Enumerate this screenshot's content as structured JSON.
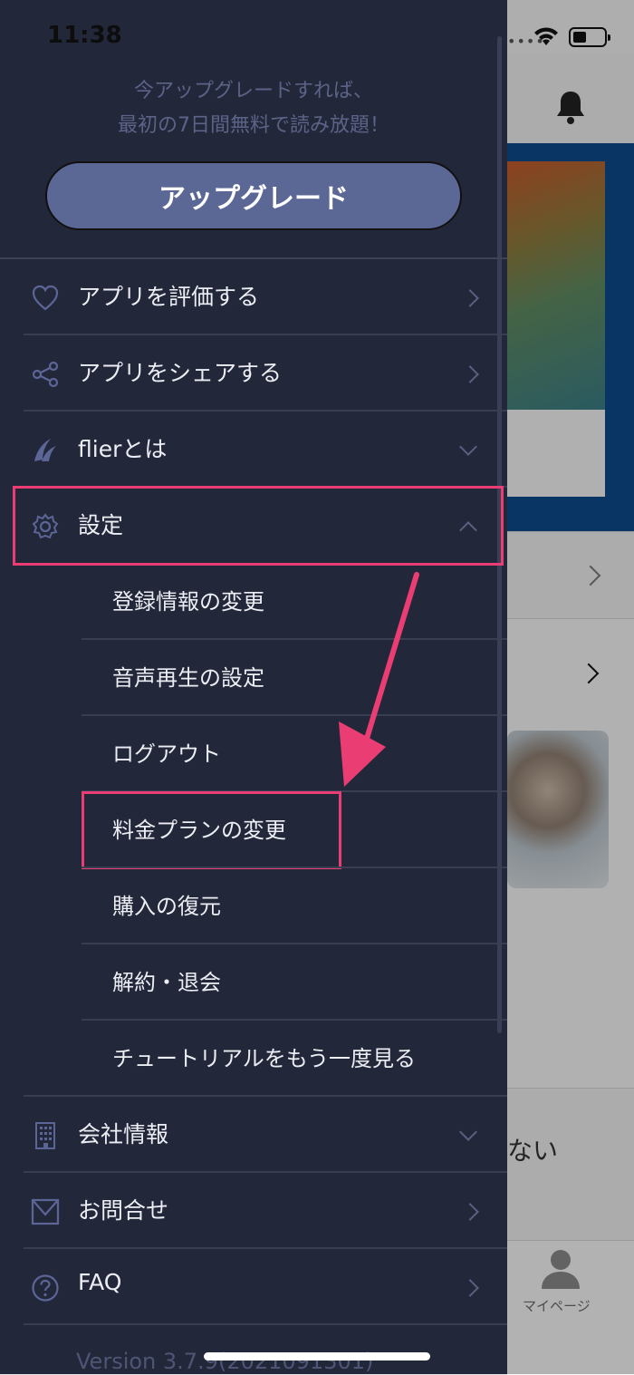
{
  "status_bar": {
    "time": "11:38"
  },
  "drawer": {
    "promo_line1": "今アップグレードすれば、",
    "promo_line2": "最初の7日間無料で読み放題！",
    "upgrade_button": "アップグレード",
    "menu": [
      {
        "label": "アプリを評価する",
        "icon": "heart-icon",
        "chevron": "right"
      },
      {
        "label": "アプリをシェアする",
        "icon": "share-icon",
        "chevron": "right"
      },
      {
        "label": "flierとは",
        "icon": "flier-logo-icon",
        "chevron": "down"
      },
      {
        "label": "設定",
        "icon": "gear-icon",
        "chevron": "up"
      }
    ],
    "settings_items": [
      "登録情報の変更",
      "音声再生の設定",
      "ログアウト",
      "料金プランの変更",
      "購入の復元",
      "解約・退会",
      "チュートリアルをもう一度見る"
    ],
    "menu_bottom": [
      {
        "label": "会社情報",
        "icon": "building-icon",
        "chevron": "down"
      },
      {
        "label": "お問合せ",
        "icon": "mail-icon",
        "chevron": "right"
      },
      {
        "label": "FAQ",
        "icon": "question-circle-icon",
        "chevron": "right"
      }
    ],
    "version": "Version  3.7.9(2021091301)"
  },
  "background": {
    "partial_text": "ない",
    "tab_label": "マイページ"
  },
  "colors": {
    "drawer_bg": "#23273a",
    "upgrade_button": "#5b6795",
    "highlight": "#ea3d73",
    "banner": "#0d4a8c"
  }
}
